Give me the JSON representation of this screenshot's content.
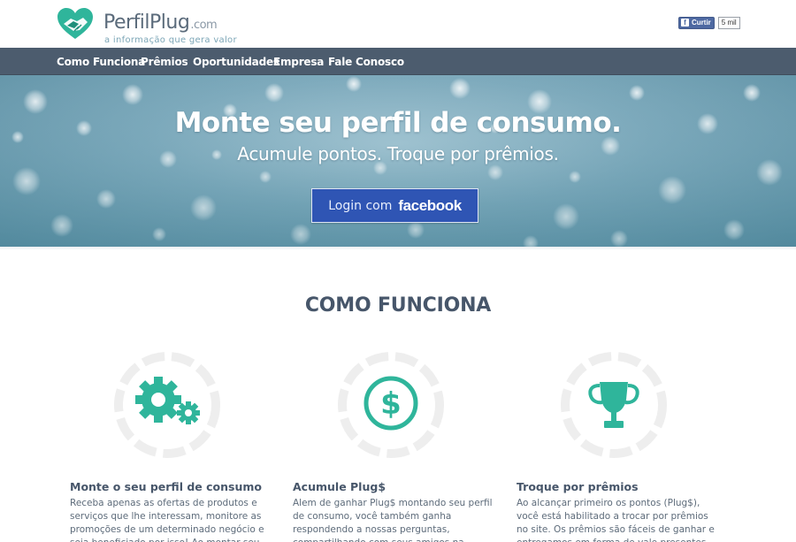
{
  "brand": {
    "name": "PerfilPlug",
    "tld": ".com",
    "tagline": "a informação que gera valor"
  },
  "facebook_like": {
    "label": "Curtir",
    "count": "5 mil"
  },
  "nav": {
    "items": [
      {
        "label": "Como Funciona"
      },
      {
        "label": "Prêmios"
      },
      {
        "label": "Oportunidades"
      },
      {
        "label": "Empresa"
      },
      {
        "label": "Fale Conosco"
      }
    ]
  },
  "hero": {
    "title": "Monte seu perfil de consumo.",
    "subtitle": "Acumule pontos. Troque por prêmios.",
    "login": {
      "text": "Login com",
      "brand": "facebook"
    }
  },
  "como_funciona": {
    "title": "COMO FUNCIONA",
    "features": [
      {
        "icon": "gears-icon",
        "title": "Monte o seu perfil de consumo",
        "text": "Receba apenas as ofertas de produtos e serviços que lhe interessam, monitore as promoções de um determinado negócio e seja beneficiado por isso! Ao montar seu perfil de"
      },
      {
        "icon": "dollar-coin-icon",
        "title": "Acumule Plug$",
        "text": "Alem de ganhar Plug$ montando seu perfil de consumo, você também ganha respondendo a nossas perguntas, compartilhando com seus amigos na internet, e também ao consumir nos"
      },
      {
        "icon": "trophy-icon",
        "title": "Troque por prêmios",
        "text": "Ao alcançar primeiro os pontos (Plug$), você está habilitado a trocar por prêmios no site. Os prêmios são fáceis de ganhar e entregamos em forma de vale presentes para gastar como"
      }
    ]
  },
  "colors": {
    "accent": "#2fb59b",
    "nav_bg": "#4c5c6e",
    "heading": "#47566a",
    "facebook_blue": "#2f55b4"
  }
}
